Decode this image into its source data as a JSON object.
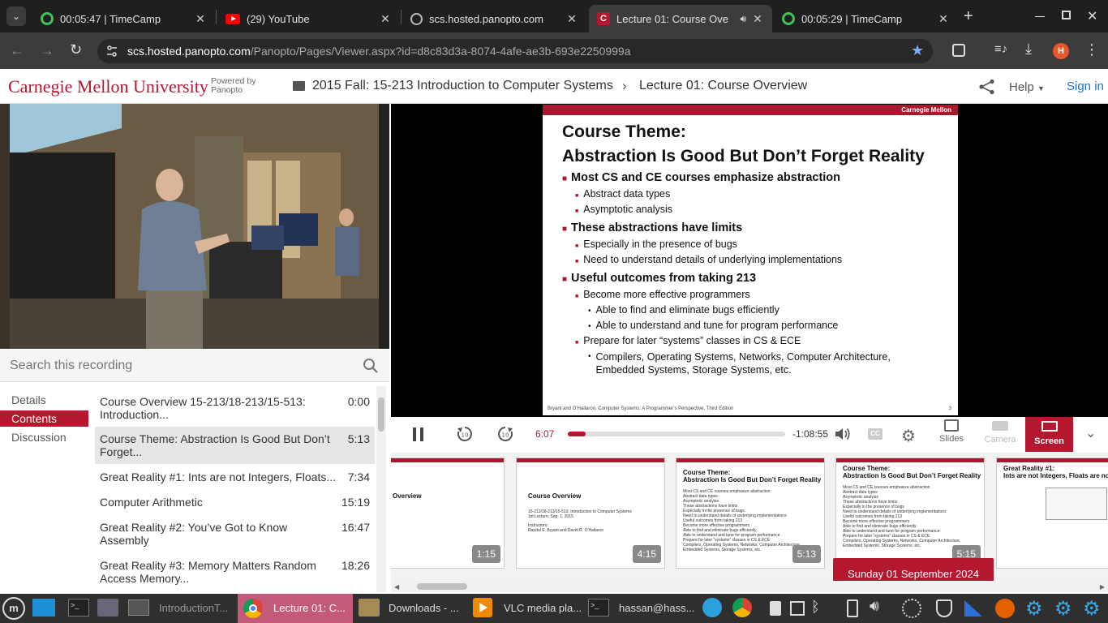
{
  "browser": {
    "tabs": [
      {
        "title": "00:05:47 | TimeCamp",
        "icon": "timecamp-icon"
      },
      {
        "title": "(29) YouTube",
        "icon": "youtube-icon"
      },
      {
        "title": "scs.hosted.panopto.com",
        "icon": "globe-icon"
      },
      {
        "title": "Lecture 01: Course Ove",
        "icon": "cmu-icon",
        "active": true
      },
      {
        "title": "00:05:29 | TimeCamp",
        "icon": "timecamp-icon"
      }
    ],
    "url_host": "scs.hosted.panopto.com",
    "url_path": "/Panopto/Pages/Viewer.aspx?id=d8c83d3a-8074-4afe-ae3b-693e2250999a",
    "profile_initial": "H"
  },
  "header": {
    "logo_text": "Carnegie Mellon University",
    "powered_by": "Powered by",
    "panopto": "Panopto",
    "folder": "2015 Fall: 15-213 Introduction to Computer Systems",
    "session": "Lecture 01: Course Overview",
    "help": "Help",
    "sign_in": "Sign in"
  },
  "search": {
    "placeholder": "Search this recording"
  },
  "nav": {
    "items": [
      "Details",
      "Contents",
      "Discussion"
    ],
    "selected": "Contents"
  },
  "contents": [
    {
      "title": "Course Overview 15-213/18-213/15-513: Introduction...",
      "time": "0:00"
    },
    {
      "title": "Course Theme: Abstraction Is Good But Don’t Forget...",
      "time": "5:13",
      "selected": true
    },
    {
      "title": "Great Reality #1: Ints are not Integers, Floats...",
      "time": "7:34"
    },
    {
      "title": "Computer Arithmetic",
      "time": "15:19"
    },
    {
      "title": "Great Reality #2: You’ve Got to Know Assembly",
      "time": "16:47"
    },
    {
      "title": "Great Reality #3: Memory Matters Random Access Memory...",
      "time": "18:26"
    }
  ],
  "slide": {
    "brand": "Carnegie Mellon",
    "title1": "Course Theme:",
    "title2": "Abstraction Is Good But Don’t Forget Reality",
    "b1": "Most CS and CE courses emphasize abstraction",
    "b1a": "Abstract data types",
    "b1b": "Asymptotic analysis",
    "b2": "These abstractions have limits",
    "b2a": "Especially in the presence of bugs",
    "b2b": "Need to understand details of underlying implementations",
    "b3": "Useful outcomes from taking 213",
    "b3a": "Become more effective programmers",
    "b3a1": "Able to find and eliminate bugs efficiently",
    "b3a2": "Able to understand and tune for program performance",
    "b3b": "Prepare for later “systems” classes in CS & ECE",
    "b3b1": "Compilers, Operating Systems, Networks, Computer Architecture, Embedded Systems, Storage Systems, etc.",
    "footer": "Bryant and O’Hallaron, Computer Systems: A Programmer’s Perspective, Third Edition",
    "page": "3"
  },
  "player": {
    "elapsed": "6:07",
    "remaining": "-1:08:55",
    "progress_fraction": 0.082,
    "slides_label": "Slides",
    "camera_label": "Camera",
    "screen_label": "Screen"
  },
  "thumbs": [
    {
      "title": "Overview",
      "badge": "1:15"
    },
    {
      "title": "Course Overview",
      "badge": "4:15",
      "sub": "15-213/18-213/15-513: Introduction to Computer Systems",
      "sub2": "1st Lecture, Sep. 1, 2015",
      "instr": "Instructors:",
      "names": "Randal E. Bryant and David R. O’Hallaron"
    },
    {
      "title": "Course Theme:",
      "title2": "Abstraction Is Good But Don’t Forget Reality",
      "badge": "5:13"
    },
    {
      "title": "Course Theme:",
      "title2": "Abstraction Is Good But Don’t Forget Reality",
      "badge": "5:15"
    },
    {
      "title": "Great Reality #1:",
      "title2": "Ints are not Integers, Floats are no"
    }
  ],
  "date_toast": "Sunday 01 September 2024",
  "taskbar": {
    "items": [
      "IntroductionT...",
      "Lecture 01: C...",
      "Downloads - ...",
      "VLC media pla...",
      "hassan@hass..."
    ]
  }
}
